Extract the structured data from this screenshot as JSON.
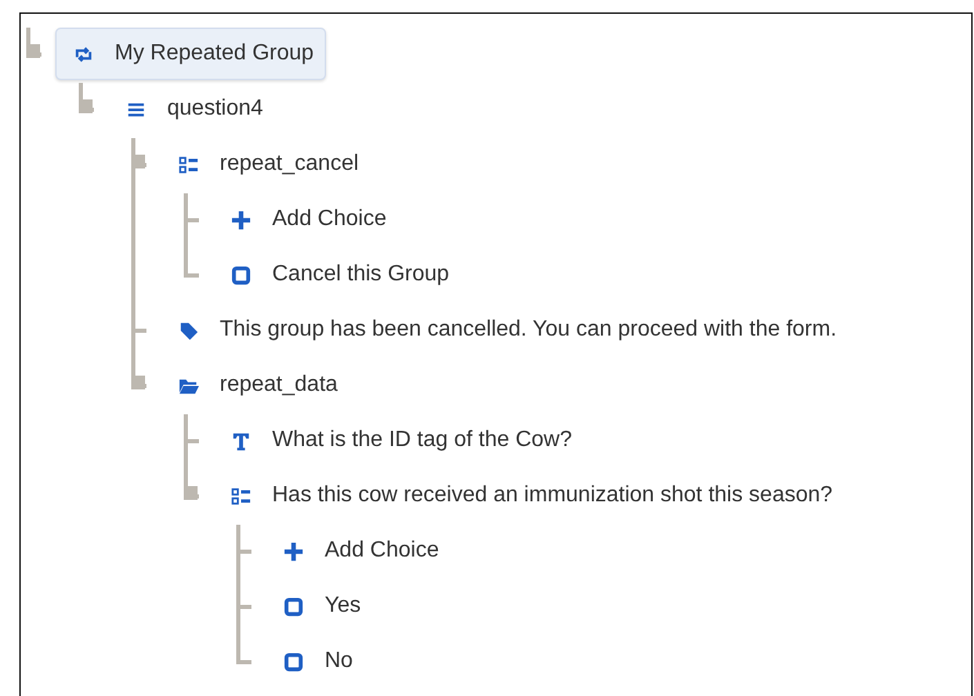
{
  "tree": [
    {
      "label": "My Repeated Group",
      "kind": "repeat",
      "selected": true,
      "children": [
        {
          "label": "question4",
          "kind": "list",
          "selected": false,
          "children": [
            {
              "label": "repeat_cancel",
              "kind": "select",
              "selected": false,
              "children": [
                {
                  "label": "Add Choice",
                  "kind": "add",
                  "selected": false
                },
                {
                  "label": "Cancel this Group",
                  "kind": "choice",
                  "selected": false
                }
              ]
            },
            {
              "label": "This group has been cancelled. You can proceed with the form.",
              "kind": "note",
              "selected": false
            },
            {
              "label": "repeat_data",
              "kind": "folder",
              "selected": false,
              "children": [
                {
                  "label": "What is the ID tag of the Cow?",
                  "kind": "text",
                  "selected": false
                },
                {
                  "label": "Has this cow received an immunization shot this season?",
                  "kind": "select",
                  "selected": false,
                  "children": [
                    {
                      "label": "Add Choice",
                      "kind": "add",
                      "selected": false
                    },
                    {
                      "label": "Yes",
                      "kind": "choice",
                      "selected": false
                    },
                    {
                      "label": "No",
                      "kind": "choice",
                      "selected": false
                    }
                  ]
                }
              ]
            }
          ]
        }
      ]
    }
  ]
}
